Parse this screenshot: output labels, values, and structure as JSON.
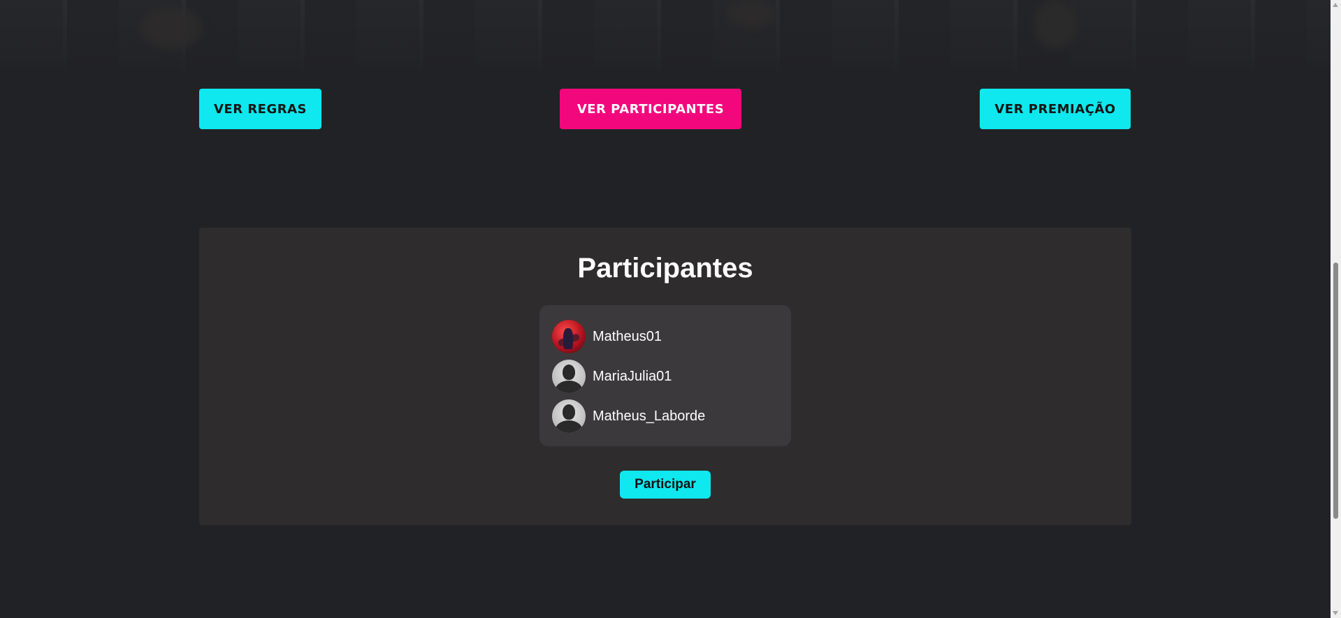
{
  "tabs": {
    "rules": "Ver Regras",
    "participants": "Ver Participantes",
    "prizes": "Ver Premiação"
  },
  "participants_panel": {
    "title": "Participantes",
    "list": [
      {
        "name": "Matheus01",
        "avatar": "photo-avatar"
      },
      {
        "name": "MariaJulia01",
        "avatar": "default-user-avatar"
      },
      {
        "name": "Matheus_Laborde",
        "avatar": "default-user-avatar"
      }
    ],
    "join_label": "Participar"
  },
  "colors": {
    "background": "#212226",
    "accent_cyan": "#0ee8ee",
    "accent_pink": "#f2087c",
    "panel": "#2e2c2d",
    "card": "#3b393b"
  }
}
